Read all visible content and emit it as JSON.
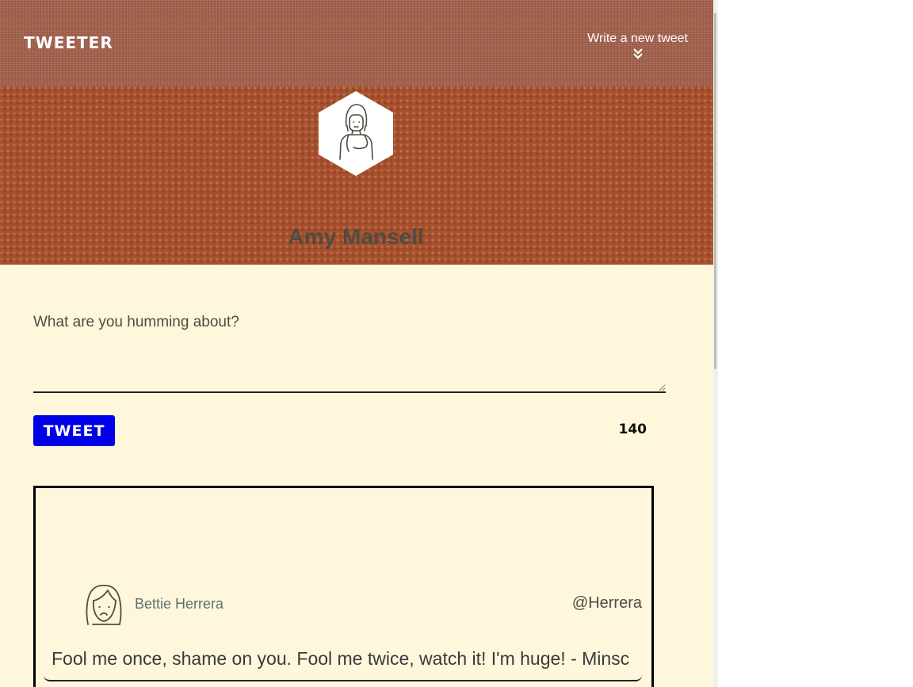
{
  "nav": {
    "brand": "TWEETER",
    "compose_toggle_label": "Write a new tweet",
    "compose_toggle_icon": "double-chevron-down-icon"
  },
  "profile": {
    "name": "Amy Mansell",
    "avatar_icon": "person-avatar-icon"
  },
  "compose": {
    "placeholder": "What are you humming about?",
    "value": "",
    "submit_label": "TWEET",
    "counter": "140"
  },
  "tweets": [
    {
      "author_name": "Bettie Herrera",
      "handle": "@Herrera",
      "text": "Fool me once, shame on you. Fool me twice, watch it! I'm huge! - Minsc",
      "avatar_icon": "woman-frowning-avatar-icon"
    }
  ],
  "colors": {
    "nav_background": "#a4614b",
    "hero_background": "#a6502e",
    "page_background": "#fff7dc",
    "button": "#0000e6",
    "text": "#4d4d42"
  }
}
